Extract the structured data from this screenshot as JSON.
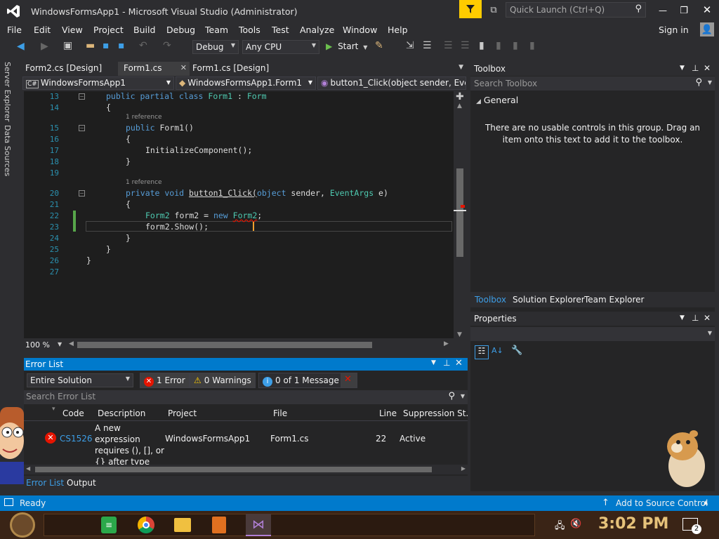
{
  "title": "WindowsFormsApp1 - Microsoft Visual Studio  (Administrator)",
  "quick_launch_placeholder": "Quick Launch (Ctrl+Q)",
  "menu": [
    "File",
    "Edit",
    "View",
    "Project",
    "Build",
    "Debug",
    "Team",
    "Tools",
    "Test",
    "Analyze",
    "Window",
    "Help"
  ],
  "sign_in": "Sign in",
  "toolbar": {
    "config": "Debug",
    "platform": "Any CPU",
    "start": "Start"
  },
  "left_tabs": [
    "Server Explorer",
    "Data Sources"
  ],
  "doc_tabs": [
    "Form2.cs [Design]",
    "Form1.cs",
    "Form1.cs [Design]"
  ],
  "nav": {
    "project": "WindowsFormsApp1",
    "class": "WindowsFormsApp1.Form1",
    "member": "button1_Click(object sender, Eve"
  },
  "code": {
    "line_numbers": [
      "13",
      "14",
      "15",
      "16",
      "17",
      "18",
      "19",
      "20",
      "21",
      "22",
      "23",
      "24",
      "25",
      "26",
      "27"
    ],
    "ref1": "1 reference",
    "ref2": "1 reference",
    "l13a": "public partial class ",
    "l13b": "Form1",
    "l13c": " : ",
    "l13d": "Form",
    "l14": "{",
    "l15a": "public ",
    "l15b": "Form1()",
    "l16": "{",
    "l17": "InitializeComponent();",
    "l18": "}",
    "l20a": "private void ",
    "l20b": "button1_Click(",
    "l20c": "object",
    "l20d": " sender, ",
    "l20e": "EventArgs",
    "l20f": " e)",
    "l21": "{",
    "l22a": "Form2",
    "l22b": " form2 = ",
    "l22c": "new ",
    "l22d": "Form2",
    "l22e": ";",
    "l23": "form2.Show();",
    "l24": "}",
    "l25": "}",
    "l26": "}"
  },
  "zoom": "100 %",
  "error_list": {
    "title": "Error List",
    "scope": "Entire Solution",
    "errors": "1 Error",
    "warnings": "0 Warnings",
    "messages": "0 of 1 Message",
    "search_placeholder": "Search Error List",
    "columns": [
      "Code",
      "Description",
      "Project",
      "File",
      "Line",
      "Suppression St..."
    ],
    "row": {
      "code": "CS1526",
      "description": "A new expression requires (), [], or {} after type",
      "project": "WindowsFormsApp1",
      "file": "Form1.cs",
      "line": "22",
      "suppression": "Active"
    },
    "tabs": [
      "Error List",
      "Output"
    ]
  },
  "toolbox": {
    "title": "Toolbox",
    "search_placeholder": "Search Toolbox",
    "group": "General",
    "empty_msg": "There are no usable controls in this group. Drag an item onto this text to add it to the toolbox.",
    "tabs": [
      "Toolbox",
      "Solution Explorer",
      "Team Explorer"
    ]
  },
  "properties_title": "Properties",
  "status": {
    "ready": "Ready",
    "source_control": "Add to Source Control"
  },
  "clock": "3:02 PM",
  "notif_count": "2",
  "colors": {
    "accent": "#007acc",
    "error": "#e51400",
    "vs_purple": "#68217a"
  }
}
